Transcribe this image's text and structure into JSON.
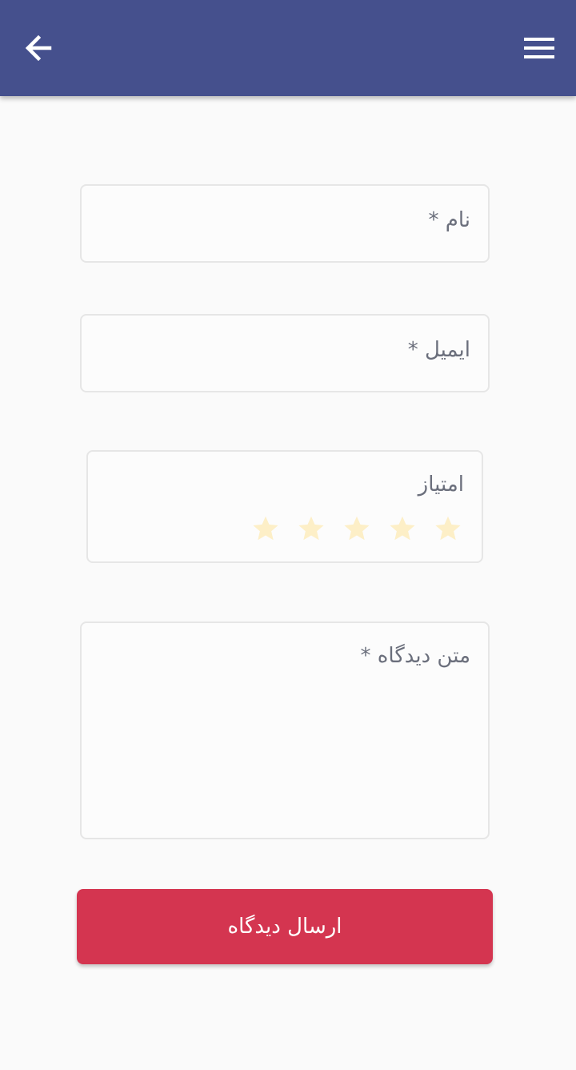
{
  "app_bar": {
    "background_color": "#45508d",
    "back_icon": "arrow-left-icon",
    "menu_icon": "hamburger-menu-icon"
  },
  "form": {
    "name_field": {
      "label": "نام *",
      "value": ""
    },
    "email_field": {
      "label": "ایمیل *",
      "value": ""
    },
    "rating_field": {
      "label": "امتیاز",
      "max_stars": 5,
      "selected": 0,
      "star_icon": "star-icon",
      "star_color": "#fdefc7"
    },
    "comment_field": {
      "label": "متن دیدگاه *",
      "value": ""
    }
  },
  "submit_button": {
    "label": "ارسال دیدگاه",
    "color": "#d43550"
  }
}
